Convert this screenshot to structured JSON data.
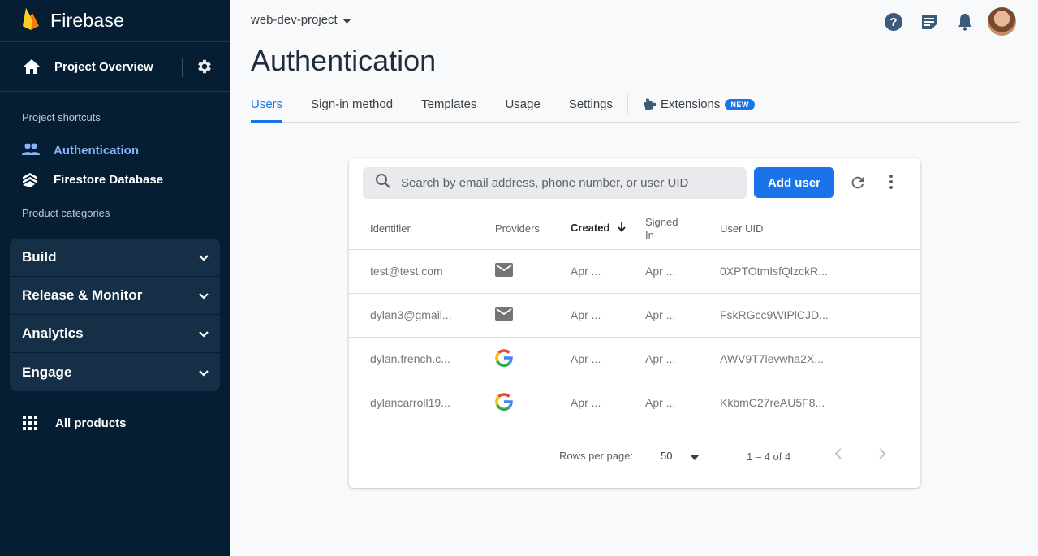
{
  "sidebar": {
    "brand": "Firebase",
    "overview_label": "Project Overview",
    "shortcuts_heading": "Project shortcuts",
    "shortcuts": [
      {
        "label": "Authentication",
        "icon": "people-icon",
        "active": true
      },
      {
        "label": "Firestore Database",
        "icon": "firestore-icon",
        "active": false
      }
    ],
    "categories_heading": "Product categories",
    "categories": [
      {
        "label": "Build"
      },
      {
        "label": "Release & Monitor"
      },
      {
        "label": "Analytics"
      },
      {
        "label": "Engage"
      }
    ],
    "all_products": "All products"
  },
  "header": {
    "project": "web-dev-project",
    "title": "Authentication"
  },
  "tabs": [
    {
      "label": "Users",
      "active": true
    },
    {
      "label": "Sign-in method",
      "active": false
    },
    {
      "label": "Templates",
      "active": false
    },
    {
      "label": "Usage",
      "active": false
    },
    {
      "label": "Settings",
      "active": false
    }
  ],
  "extensions_tab": {
    "label": "Extensions",
    "badge": "NEW"
  },
  "users": {
    "search_placeholder": "Search by email address, phone number, or user UID",
    "add_user_label": "Add user",
    "columns": {
      "identifier": "Identifier",
      "providers": "Providers",
      "created": "Created",
      "signed_in_1": "Signed",
      "signed_in_2": "In",
      "uid": "User UID"
    },
    "rows": [
      {
        "identifier": "test@test.com",
        "provider": "email",
        "created": "Apr ...",
        "signed_in": "Apr ...",
        "uid": "0XPTOtmIsfQlzckR..."
      },
      {
        "identifier": "dylan3@gmail...",
        "provider": "email",
        "created": "Apr ...",
        "signed_in": "Apr ...",
        "uid": "FskRGcc9WIPlCJD..."
      },
      {
        "identifier": "dylan.french.c...",
        "provider": "google",
        "created": "Apr ...",
        "signed_in": "Apr ...",
        "uid": "AWV9T7ievwha2X..."
      },
      {
        "identifier": "dylancarroll19...",
        "provider": "google",
        "created": "Apr ...",
        "signed_in": "Apr ...",
        "uid": "KkbmC27reAU5F8..."
      }
    ],
    "pager": {
      "rows_per_page_label": "Rows per page:",
      "rows_per_page": "50",
      "range": "1 – 4 of 4"
    }
  },
  "colors": {
    "sidebar_bg": "#051e34",
    "accent": "#1a73e8",
    "active_nav": "#8ab4f8"
  }
}
